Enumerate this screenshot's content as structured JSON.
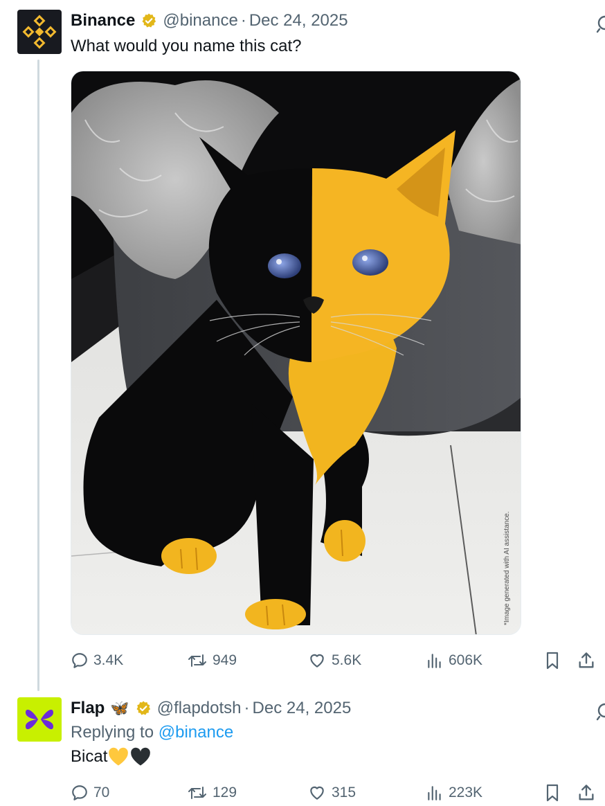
{
  "tweet": {
    "author_name": "Binance",
    "handle": "@binance",
    "separator": "·",
    "date": "Dec 24, 2025",
    "text": "What would you name this cat?",
    "media": {
      "alt": "Half black, half yellow kitten sitting in front of a fluffy grey cat bed",
      "watermark": "*Image generated with AI assistance."
    },
    "stats": {
      "replies": "3.4K",
      "reposts": "949",
      "likes": "5.6K",
      "views": "606K"
    }
  },
  "reply": {
    "author_name": "Flap",
    "name_emoji": "🦋",
    "handle": "@flapdotsh",
    "separator": "·",
    "date": "Dec 24, 2025",
    "replying_label": "Replying to",
    "replying_handle": "@binance",
    "text": "Bicat",
    "text_emojis": [
      "yellow-heart",
      "black-heart"
    ],
    "stats": {
      "replies": "70",
      "reposts": "129",
      "likes": "315",
      "views": "223K"
    }
  },
  "colors": {
    "binance_yellow": "#F3BA2F",
    "binance_black": "#181a20",
    "flap_green": "#c8f000",
    "flap_purple": "#6b2bd9",
    "verified_gold": "#E2B719",
    "link_blue": "#1d9bf0",
    "muted_text": "#536471"
  }
}
